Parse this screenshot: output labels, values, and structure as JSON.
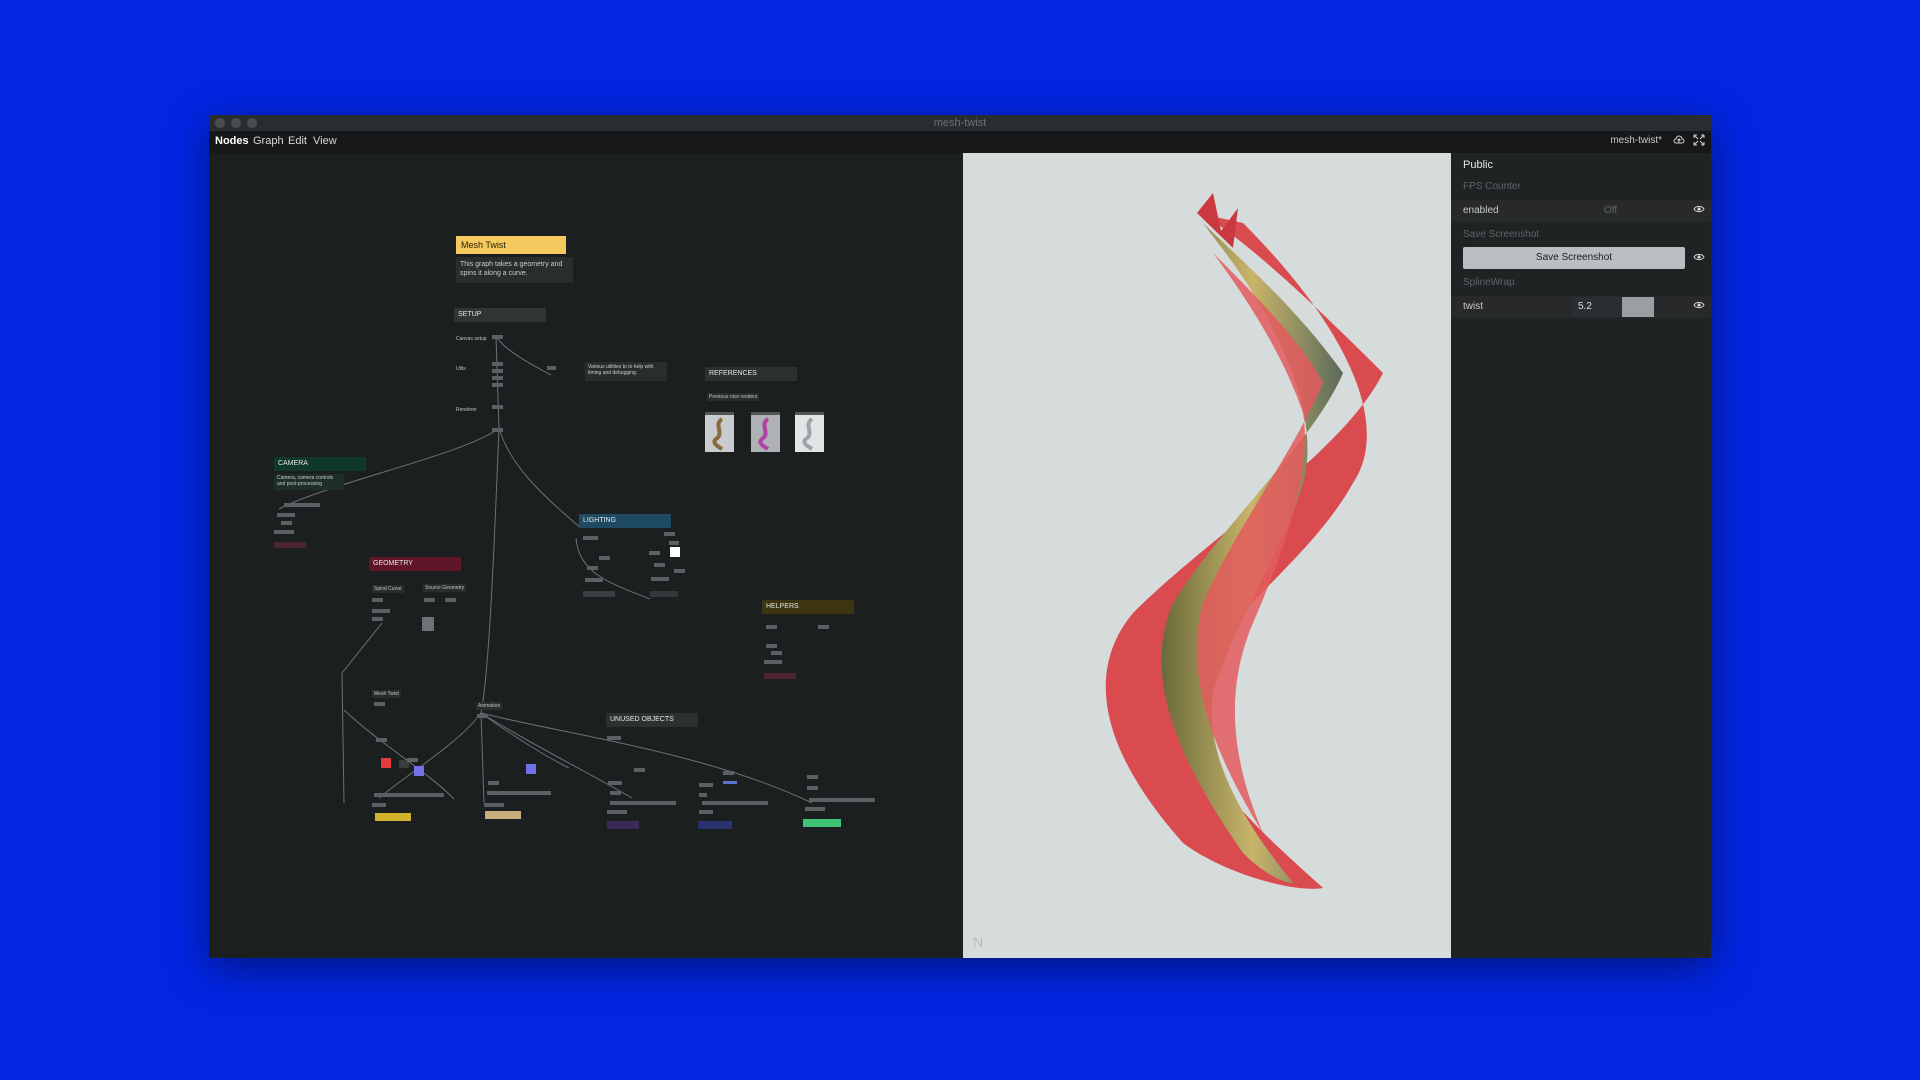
{
  "window": {
    "title": "mesh-twist"
  },
  "menubar": {
    "items": [
      "Nodes",
      "Graph",
      "Edit",
      "View"
    ],
    "project": "mesh-twist*",
    "icons": [
      "cloud-upload-icon",
      "fullscreen-icon"
    ]
  },
  "graph": {
    "title_note": "Mesh Twist",
    "description": "This graph takes a geometry and spins it along a curve.",
    "groups": {
      "setup": "SETUP",
      "references": "REFERENCES",
      "camera": "CAMERA",
      "lighting": "LIGHTING",
      "geometry": "GEOMETRY",
      "helpers": "HELPERS",
      "unused": "UNUSED OBJECTS"
    },
    "labels": {
      "canvas_setup": "Canvas setup",
      "utils": "Utils",
      "renderer": "Renderer",
      "utils_note": "Various utilities to to help with timing and debugging.",
      "previous_renders": "Previous nice renders",
      "camera_note": "Camera, camera controls and post-processing",
      "spiral_curve": "Spiral Curve",
      "source_geometry": "Source Geometry",
      "mesh_twist": "Mesh Twist",
      "animation": "Animation"
    },
    "group_colors": {
      "title": "#f4c95d",
      "camera": "#11382c",
      "lighting": "#1f4a63",
      "geometry": "#5e1628",
      "helpers": "#3d3411"
    }
  },
  "preview": {
    "watermark": "N"
  },
  "panel": {
    "title": "Public",
    "fps_section": "FPS Counter",
    "fps_label": "enabled",
    "fps_value": "Off",
    "screenshot_section": "Save Screenshot",
    "screenshot_button": "Save Screenshot",
    "spline_section": "SplineWrap",
    "twist_label": "twist",
    "twist_value": "5.2"
  }
}
